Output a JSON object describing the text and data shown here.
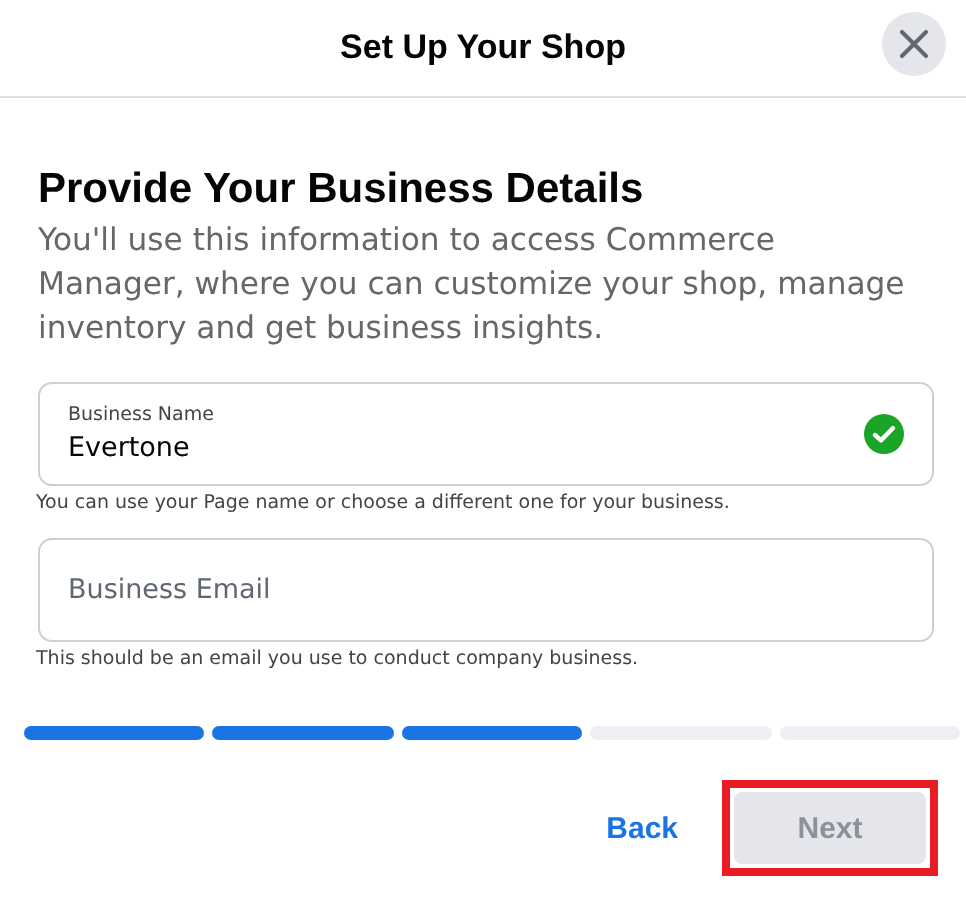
{
  "dialog": {
    "title": "Set Up Your Shop"
  },
  "heading": "Provide Your Business Details",
  "description": "You'll use this information to access Commerce Manager, where you can customize your shop, manage inventory and get business insights.",
  "fields": [
    {
      "label": "Business Name",
      "value": "Evertone",
      "valid": true,
      "help": "You can use your Page name or choose a different one for your business."
    },
    {
      "placeholder": "Business Email",
      "valid": false,
      "help": "This should be an email you use to conduct company business."
    }
  ],
  "progress": [
    {
      "done": true
    },
    {
      "done": true
    },
    {
      "done": true
    },
    {
      "done": false
    },
    {
      "done": false
    }
  ],
  "buttons": {
    "back": "Back",
    "next": {
      "label": "Next",
      "disabled": true,
      "highlighted": true
    }
  }
}
